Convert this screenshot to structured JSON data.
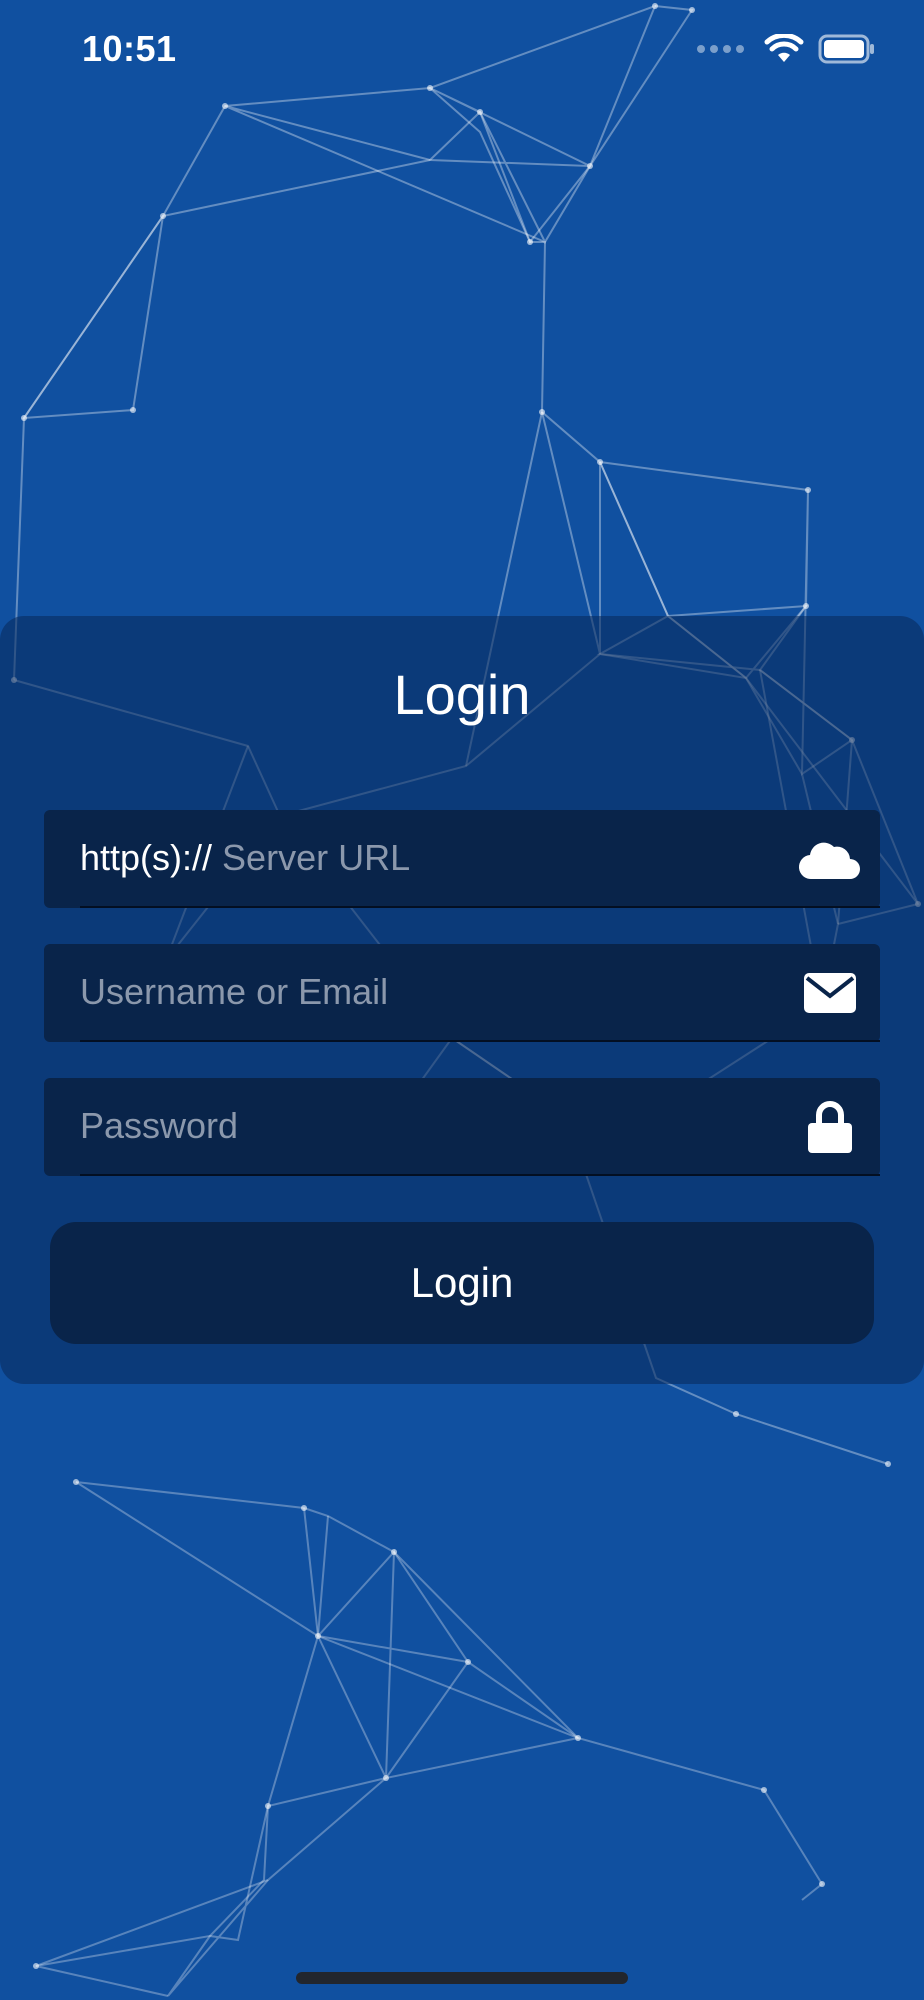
{
  "status_bar": {
    "time": "10:51",
    "icons": [
      "cellular-signal-icon",
      "wifi-icon",
      "battery-icon"
    ]
  },
  "colors": {
    "background": "#1050a0",
    "card": "#0a2e62",
    "field": "#09244a",
    "placeholder": "#8b98ac",
    "text": "#ffffff"
  },
  "login": {
    "title": "Login",
    "server_field": {
      "prefix": "http(s)://",
      "placeholder": "Server URL",
      "icon": "cloud-icon"
    },
    "username_field": {
      "placeholder": "Username or Email",
      "icon": "envelope-icon"
    },
    "password_field": {
      "placeholder": "Password",
      "icon": "lock-icon"
    },
    "button_label": "Login"
  }
}
